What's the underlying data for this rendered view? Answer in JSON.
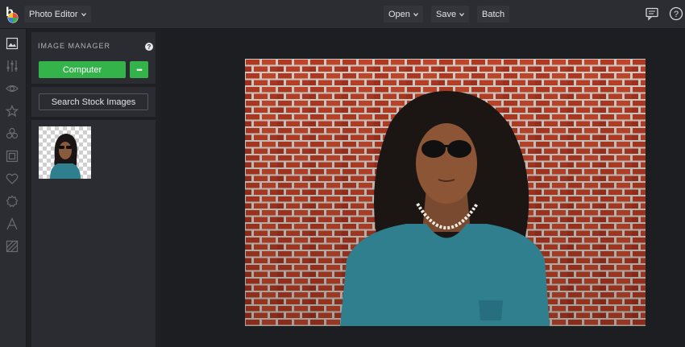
{
  "app": {
    "logo_letter": "b",
    "menu_label": "Photo Editor"
  },
  "toolbar": {
    "open_label": "Open",
    "save_label": "Save",
    "batch_label": "Batch",
    "icons": [
      "chat-icon",
      "help-icon"
    ]
  },
  "rail": {
    "icons": [
      "image-manager-icon",
      "adjustments-icon",
      "eye-icon",
      "star-icon",
      "overlay-icon",
      "frame-icon",
      "heart-icon",
      "texture-icon",
      "text-icon",
      "graphics-icon"
    ]
  },
  "panel": {
    "title": "IMAGE MANAGER",
    "help_glyph": "?",
    "computer_label": "Computer",
    "more_glyph": "•••",
    "stock_label": "Search Stock Images"
  },
  "colors": {
    "accent_green": "#33b34a",
    "brick": "#b5402a",
    "shirt": "#2f7f8f"
  }
}
